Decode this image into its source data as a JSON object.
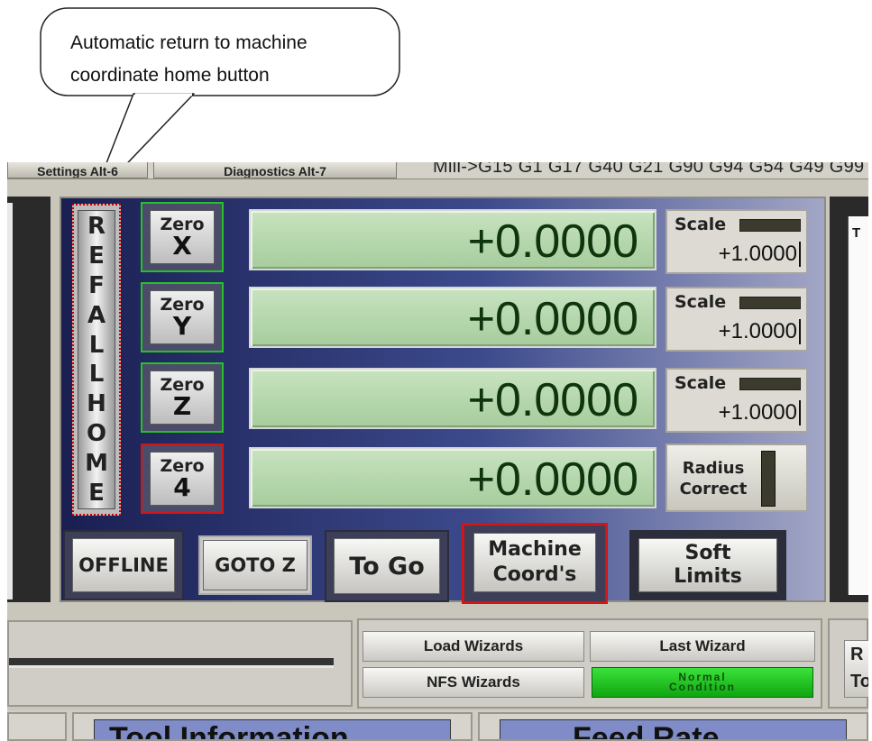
{
  "callout": {
    "line1": "Automatic return to machine",
    "line2": "coordinate home button"
  },
  "topbar": {
    "tab_settings": "Settings Alt-6",
    "tab_diagnostics": "Diagnostics Alt-7",
    "gcode_modes": "Mill->G15  G1 G17 G40 G21 G90 G94 G54 G49 G99"
  },
  "ref_home": {
    "letters": [
      "R",
      "E",
      "F",
      "A",
      "L",
      "L",
      "H",
      "O",
      "M",
      "E"
    ]
  },
  "axes": [
    {
      "zero_label": "Zero",
      "axis": "X",
      "value": "+0.0000",
      "zero_border": "#25c225"
    },
    {
      "zero_label": "Zero",
      "axis": "Y",
      "value": "+0.0000",
      "zero_border": "#25c225"
    },
    {
      "zero_label": "Zero",
      "axis": "Z",
      "value": "+0.0000",
      "zero_border": "#25c225"
    },
    {
      "zero_label": "Zero",
      "axis": "4",
      "value": "+0.0000",
      "zero_border": "#d41515"
    }
  ],
  "scales": [
    {
      "label": "Scale",
      "value": "+1.0000"
    },
    {
      "label": "Scale",
      "value": "+1.0000"
    },
    {
      "label": "Scale",
      "value": "+1.0000"
    }
  ],
  "radius_correct": {
    "line1": "Radius",
    "line2": "Correct"
  },
  "buttons": {
    "offline": "OFFLINE",
    "goto_z": "GOTO Z",
    "to_go": "To Go",
    "machine_coords_1": "Machine",
    "machine_coords_2": "Coord's",
    "soft_limits_1": "Soft",
    "soft_limits_2": "Limits"
  },
  "wizards": {
    "load": "Load Wizards",
    "last": "Last Wizard",
    "nfs": "NFS Wizards",
    "status_1": "Normal",
    "status_2": "Condition"
  },
  "right_edge": {
    "line1": "R",
    "line2": "To"
  },
  "bottom": {
    "tool_info": "Tool Information",
    "feed_rate": "Feed Rate"
  },
  "colors": {
    "dro_green": "#b8d9ae",
    "led_green": "#22cc22",
    "highlight_red": "#d41515",
    "zero_green_border": "#25c225"
  },
  "right_panel_letter": "T"
}
